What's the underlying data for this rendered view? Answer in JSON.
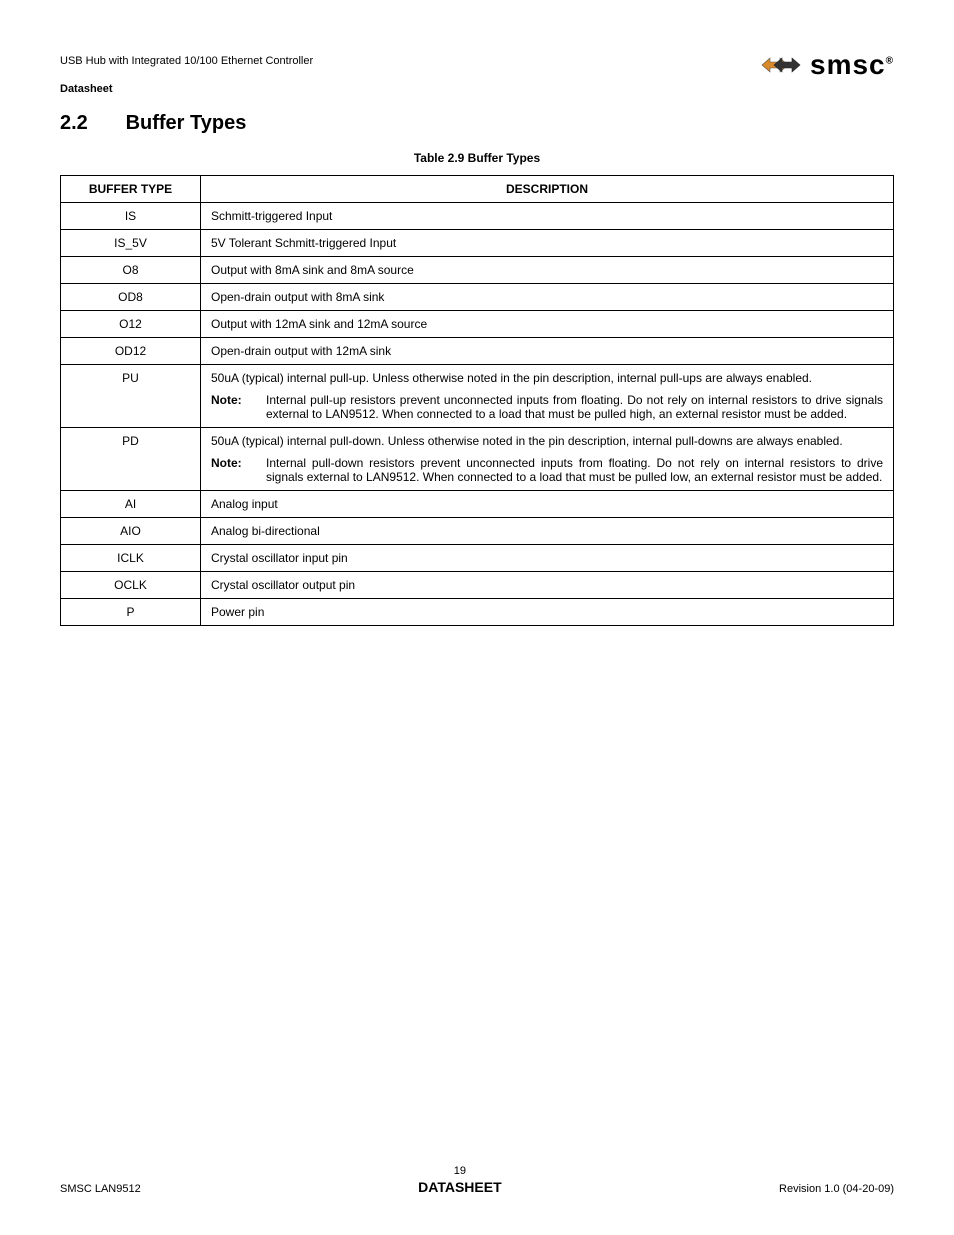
{
  "header": {
    "subtitle": "USB Hub with Integrated 10/100 Ethernet Controller",
    "doclabel": "Datasheet",
    "logo_text": "smsc",
    "logo_reg": "®"
  },
  "section": {
    "number": "2.2",
    "title": "Buffer Types"
  },
  "table": {
    "caption": "Table 2.9 Buffer Types",
    "headers": {
      "col1": "BUFFER TYPE",
      "col2": "DESCRIPTION"
    },
    "rows": [
      {
        "type": "IS",
        "desc": "Schmitt-triggered Input"
      },
      {
        "type": "IS_5V",
        "desc": "5V Tolerant Schmitt-triggered Input"
      },
      {
        "type": "O8",
        "desc": "Output with 8mA sink and 8mA source"
      },
      {
        "type": "OD8",
        "desc": "Open-drain output with 8mA sink"
      },
      {
        "type": "O12",
        "desc": "Output with 12mA sink and 12mA source"
      },
      {
        "type": "OD12",
        "desc": "Open-drain output with 12mA sink"
      },
      {
        "type": "PU",
        "desc": "50uA (typical) internal pull-up. Unless otherwise noted in the pin description, internal pull-ups are always enabled.",
        "note_label": "Note:",
        "note": "Internal pull-up resistors prevent unconnected inputs from floating. Do not rely on internal resistors to drive signals external to LAN9512. When connected to a load that must be pulled high, an external resistor must be added."
      },
      {
        "type": "PD",
        "desc": "50uA (typical) internal pull-down. Unless otherwise noted in the pin description, internal pull-downs are always enabled.",
        "note_label": "Note:",
        "note": "Internal pull-down resistors prevent unconnected inputs from floating. Do not rely on internal resistors to drive signals external to LAN9512. When connected to a load that must be pulled low, an external resistor must be added."
      },
      {
        "type": "AI",
        "desc": "Analog input"
      },
      {
        "type": "AIO",
        "desc": "Analog bi-directional"
      },
      {
        "type": "ICLK",
        "desc": "Crystal oscillator input pin"
      },
      {
        "type": "OCLK",
        "desc": "Crystal oscillator output pin"
      },
      {
        "type": "P",
        "desc": "Power pin"
      }
    ]
  },
  "footer": {
    "left": "SMSC LAN9512",
    "page": "19",
    "title": "DATASHEET",
    "right": "Revision 1.0 (04-20-09)"
  }
}
